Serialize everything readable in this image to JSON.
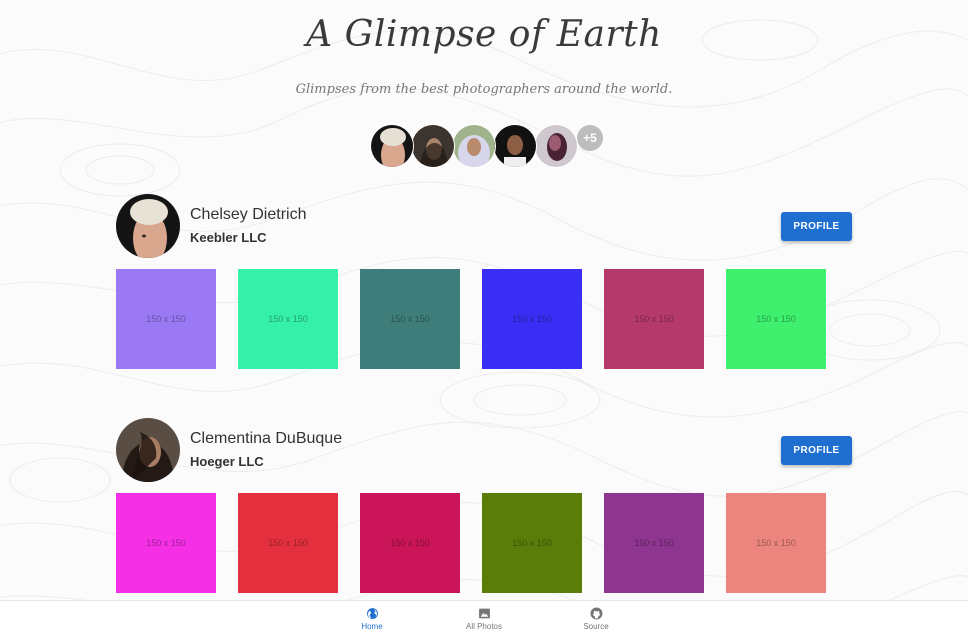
{
  "header": {
    "title": "A Glimpse of Earth",
    "subtitle": "Glimpses from the best photographers around the world."
  },
  "avatar_stack": {
    "more_label": "+5"
  },
  "photographers": [
    {
      "name": "Chelsey Dietrich",
      "company": "Keebler LLC",
      "profile_button": "PROFILE",
      "photos": [
        {
          "label": "150 x 150",
          "color": "#9b79f5"
        },
        {
          "label": "150 x 150",
          "color": "#35f0a9"
        },
        {
          "label": "150 x 150",
          "color": "#3e7d79"
        },
        {
          "label": "150 x 150",
          "color": "#3a2ef5"
        },
        {
          "label": "150 x 150",
          "color": "#b53a6b"
        },
        {
          "label": "150 x 150",
          "color": "#3ef06e"
        }
      ]
    },
    {
      "name": "Clementina DuBuque",
      "company": "Hoeger LLC",
      "profile_button": "PROFILE",
      "photos": [
        {
          "label": "150 x 150",
          "color": "#f52fe6"
        },
        {
          "label": "150 x 150",
          "color": "#e4303e"
        },
        {
          "label": "150 x 150",
          "color": "#cb1559"
        },
        {
          "label": "150 x 150",
          "color": "#5a7d0a"
        },
        {
          "label": "150 x 150",
          "color": "#8e3590"
        },
        {
          "label": "150 x 150",
          "color": "#ec857e"
        }
      ]
    }
  ],
  "bottom_nav": {
    "items": [
      {
        "label": "Home",
        "icon": "globe-icon"
      },
      {
        "label": "All Photos",
        "icon": "image-icon"
      },
      {
        "label": "Source",
        "icon": "github-icon"
      }
    ]
  },
  "colors": {
    "accent": "#1e6fd0",
    "more_badge": "#bdbdbd"
  }
}
